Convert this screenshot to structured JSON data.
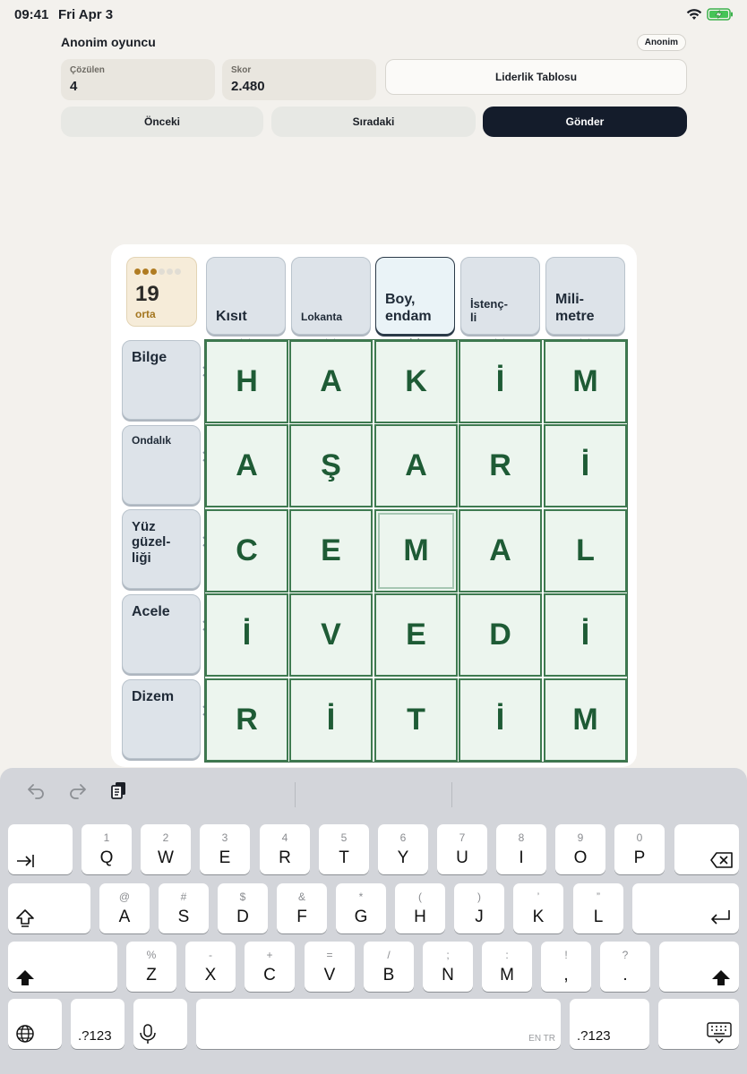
{
  "status_bar": {
    "time": "09:41",
    "date": "Fri Apr 3",
    "wifi_icon": "wifi-icon",
    "battery_icon": "battery-charging-icon"
  },
  "header": {
    "player_name": "Anonim oyuncu",
    "badge": "Anonim",
    "stats": [
      {
        "label": "Çözülen",
        "value": "4"
      },
      {
        "label": "Skor",
        "value": "2.480"
      }
    ],
    "leaderboard_label": "Liderlik Tablosu",
    "prev_label": "Önceki",
    "next_label": "Sıradaki",
    "submit_label": "Gönder"
  },
  "puzzle": {
    "level": {
      "number": "19",
      "difficulty": "orta",
      "dots_filled": 3,
      "dots_total": 6,
      "accent": "#b07c22"
    },
    "column_clues": [
      "Kısıt",
      "Lokanta",
      "Boy, endam",
      "İstenç-li",
      "Mili-metre"
    ],
    "active_column": 2,
    "row_clues": [
      "Bilge",
      "Ondalık",
      "Yüz güzel-liği",
      "Acele",
      "Dizem"
    ],
    "grid": [
      [
        "H",
        "A",
        "K",
        "İ",
        "M"
      ],
      [
        "A",
        "Ş",
        "A",
        "R",
        "İ"
      ],
      [
        "C",
        "E",
        "M",
        "A",
        "L"
      ],
      [
        "İ",
        "V",
        "E",
        "D",
        "İ"
      ],
      [
        "R",
        "İ",
        "T",
        "İ",
        "M"
      ]
    ],
    "selected_cell": {
      "row": 2,
      "col": 2
    },
    "colors": {
      "cell_bg": "#ecf5ee",
      "cell_border": "#3e7a50",
      "letter": "#1e5b35"
    }
  },
  "keyboard": {
    "toolbar": [
      "undo-icon",
      "redo-icon",
      "clipboard-icon"
    ],
    "row1": [
      {
        "sub": "1",
        "main": "Q"
      },
      {
        "sub": "2",
        "main": "W"
      },
      {
        "sub": "3",
        "main": "E"
      },
      {
        "sub": "4",
        "main": "R"
      },
      {
        "sub": "5",
        "main": "T"
      },
      {
        "sub": "6",
        "main": "Y"
      },
      {
        "sub": "7",
        "main": "U"
      },
      {
        "sub": "8",
        "main": "I"
      },
      {
        "sub": "9",
        "main": "O"
      },
      {
        "sub": "0",
        "main": "P"
      }
    ],
    "row2": [
      {
        "sub": "@",
        "main": "A"
      },
      {
        "sub": "#",
        "main": "S"
      },
      {
        "sub": "$",
        "main": "D"
      },
      {
        "sub": "&",
        "main": "F"
      },
      {
        "sub": "*",
        "main": "G"
      },
      {
        "sub": "(",
        "main": "H"
      },
      {
        "sub": ")",
        "main": "J"
      },
      {
        "sub": "’",
        "main": "K"
      },
      {
        "sub": "”",
        "main": "L"
      }
    ],
    "row3": [
      {
        "sub": "%",
        "main": "Z"
      },
      {
        "sub": "-",
        "main": "X"
      },
      {
        "sub": "+",
        "main": "C"
      },
      {
        "sub": "=",
        "main": "V"
      },
      {
        "sub": "/",
        "main": "B"
      },
      {
        "sub": ";",
        "main": "N"
      },
      {
        "sub": ":",
        "main": "M"
      },
      {
        "sub": "!",
        "main": ","
      },
      {
        "sub": "?",
        "main": "."
      }
    ],
    "numbers_label": ".?123",
    "language_hint": "EN TR"
  }
}
